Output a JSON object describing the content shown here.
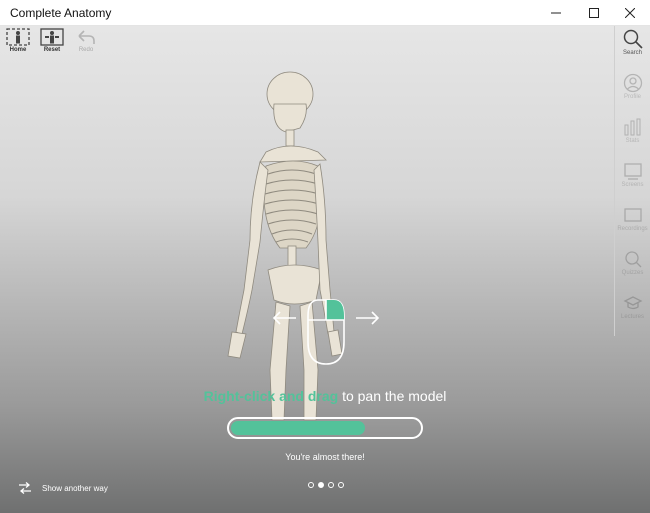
{
  "window": {
    "title": "Complete Anatomy"
  },
  "toolbar": {
    "home_label": "Home",
    "reset_label": "Reset",
    "redo_label": "Redo"
  },
  "sidebar": {
    "items": [
      {
        "label": "Search"
      },
      {
        "label": "Profile"
      },
      {
        "label": "Stats"
      },
      {
        "label": "Screens"
      },
      {
        "label": "Recordings"
      },
      {
        "label": "Quizzes"
      },
      {
        "label": "Lectures"
      }
    ]
  },
  "tutorial": {
    "highlight": "Right-click and drag",
    "rest": " to pan the model",
    "progress": 0.7,
    "encouragement": "You're almost there!",
    "show_another_label": "Show another way",
    "page_total": 4,
    "page_current": 2
  },
  "colors": {
    "accent": "#53c29a"
  }
}
